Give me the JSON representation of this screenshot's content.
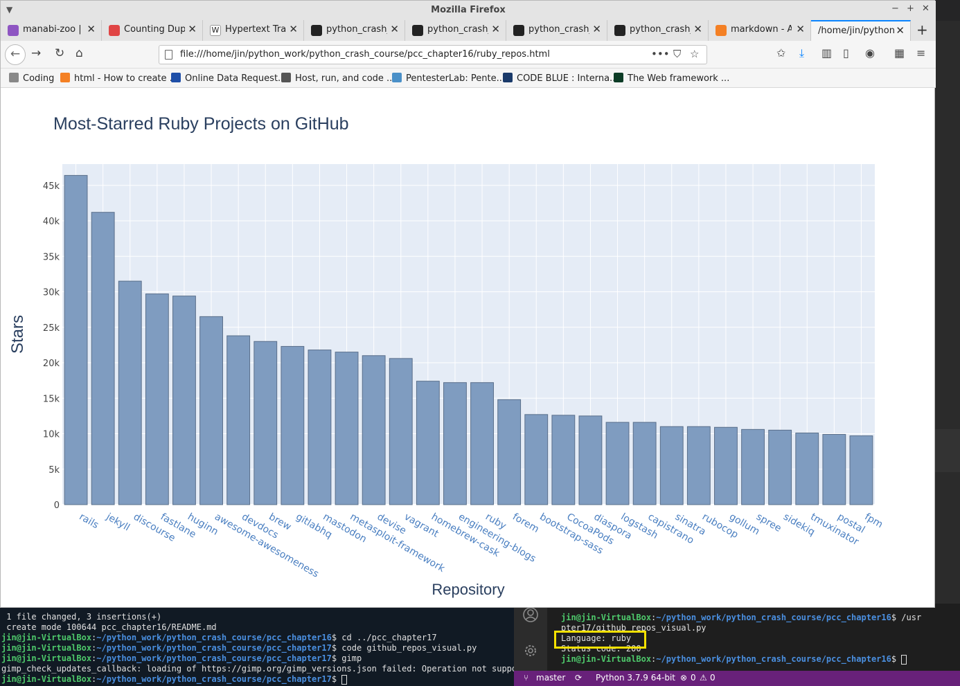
{
  "window": {
    "title": "Mozilla Firefox"
  },
  "tabs": [
    {
      "label": "manabi-zoo | H",
      "favicon_color": "#8e55c2"
    },
    {
      "label": "Counting Dupli",
      "favicon_color": "#e04545"
    },
    {
      "label": "Hypertext Tran",
      "favicon_color": "#ffffff"
    },
    {
      "label": "python_crash_c",
      "favicon_color": "#222222"
    },
    {
      "label": "python_crash_c",
      "favicon_color": "#222222"
    },
    {
      "label": "python_crash_c",
      "favicon_color": "#222222"
    },
    {
      "label": "python_crash_c",
      "favicon_color": "#222222"
    },
    {
      "label": "markdown - Ad",
      "favicon_color": "#f48024"
    },
    {
      "label": "/home/jin/python_",
      "favicon_color": ""
    }
  ],
  "url": "file:///home/jin/python_work/python_crash_course/pcc_chapter16/ruby_repos.html",
  "bookmarks": [
    {
      "label": "Coding",
      "icon": "folder-icon",
      "color": "#888888"
    },
    {
      "label": "html - How to create ...",
      "icon": "stackoverflow-icon",
      "color": "#f48024"
    },
    {
      "label": "Online Data Request...",
      "icon": "noaa-icon",
      "color": "#1f4fa8"
    },
    {
      "label": "Host, run, and code ...",
      "icon": "replit-icon",
      "color": "#555555"
    },
    {
      "label": "PentesterLab: Pente...",
      "icon": "pentesterlab-icon",
      "color": "#4a90c8"
    },
    {
      "label": "CODE BLUE : Interna...",
      "icon": "codeblue-icon",
      "color": "#1a3a6a"
    },
    {
      "label": "The Web framework ...",
      "icon": "django-icon",
      "color": "#0c3c26"
    }
  ],
  "chart_data": {
    "type": "bar",
    "title": "Most-Starred Ruby Projects on GitHub",
    "xlabel": "Repository",
    "ylabel": "Stars",
    "categories": [
      "rails",
      "jekyll",
      "discourse",
      "fastlane",
      "huginn",
      "awesome-awesomeness",
      "devdocs",
      "brew",
      "gitlabhq",
      "mastodon",
      "metasploit-framework",
      "devise",
      "vagrant",
      "homebrew-cask",
      "engineering-blogs",
      "ruby",
      "forem",
      "bootstrap-sass",
      "CocoaPods",
      "diaspora",
      "logstash",
      "capistrano",
      "sinatra",
      "rubocop",
      "gollum",
      "spree",
      "sidekiq",
      "tmuxinator",
      "postal",
      "fpm"
    ],
    "values": [
      46400,
      41200,
      31500,
      29700,
      29400,
      26500,
      23800,
      23000,
      22300,
      21800,
      21500,
      21000,
      20600,
      17400,
      17200,
      17200,
      14800,
      12700,
      12600,
      12500,
      11600,
      11600,
      11000,
      11000,
      10900,
      10600,
      10500,
      10100,
      9900,
      9700
    ],
    "ylim": [
      0,
      48000
    ],
    "yticks": [
      "0",
      "5k",
      "10k",
      "15k",
      "20k",
      "25k",
      "30k",
      "35k",
      "40k",
      "45k"
    ],
    "ytick_values": [
      0,
      5000,
      10000,
      15000,
      20000,
      25000,
      30000,
      35000,
      40000,
      45000
    ],
    "grid": true,
    "bar_color": "#7f9cc0",
    "bar_edge": "#5a6f8a",
    "plot_bg": "#e5ecf6",
    "label_color": "#4a7fc1",
    "title_color": "#2a3f5f"
  },
  "terminal_left": {
    "lines": [
      {
        "text": " 1 file changed, 3 insertions(+)"
      },
      {
        "text": " create mode 100644 pcc_chapter16/README.md"
      },
      {
        "user": "jin@jin-VirtualBox",
        "path": "~/python_work/python_crash_course/pcc_chapter16",
        "cmd": "$ cd ../pcc_chapter17"
      },
      {
        "user": "jin@jin-VirtualBox",
        "path": "~/python_work/python_crash_course/pcc_chapter17",
        "cmd": "$ code github_repos_visual.py"
      },
      {
        "user": "jin@jin-VirtualBox",
        "path": "~/python_work/python_crash_course/pcc_chapter17",
        "cmd": "$ gimp"
      },
      {
        "text": "gimp_check_updates_callback: loading of https://gimp.org/gimp_versions.json failed: Operation not supporte"
      },
      {
        "user": "jin@jin-VirtualBox",
        "path": "~/python_work/python_crash_course/pcc_chapter17",
        "cmd": "$ "
      }
    ]
  },
  "terminal_right": {
    "lines": [
      {
        "user": "jin@jin-VirtualBox",
        "path": "~/python_work/python_crash_course/pcc_chapter16",
        "cmd": "$ /usr"
      },
      {
        "text": "pter17/github_repos_visual.py"
      },
      {
        "text": "Language: ruby"
      },
      {
        "text": "Status code: 200"
      },
      {
        "user": "jin@jin-VirtualBox",
        "path": "~/python_work/python_crash_course/pcc_chapter16",
        "cmd": "$ "
      }
    ]
  },
  "statusbar": {
    "branch": "master",
    "python": "Python 3.7.9 64-bit",
    "errors": "0",
    "warnings": "0"
  }
}
